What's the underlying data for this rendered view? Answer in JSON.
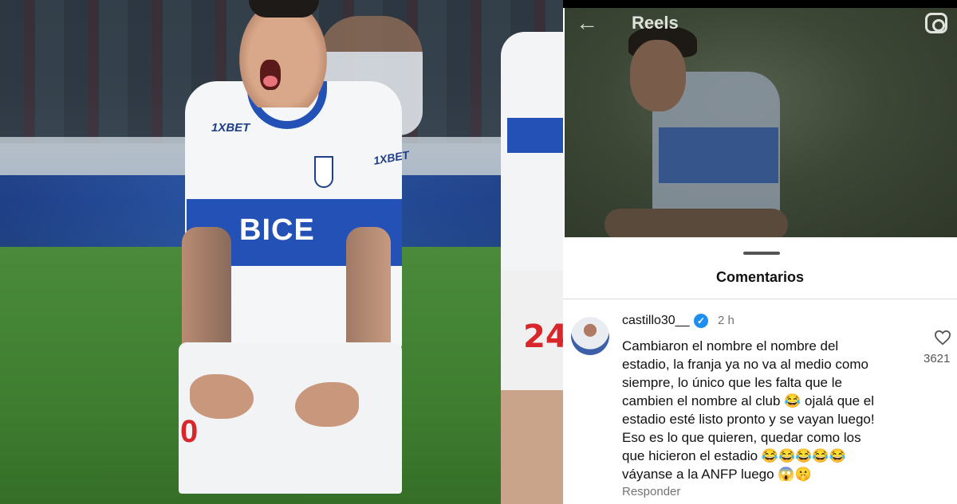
{
  "photo": {
    "shirt_sponsor": "BICE",
    "chest_logo": "1XBET",
    "sleeve_logo": "1XBET",
    "shorts_number": "0",
    "other_player_number": "24"
  },
  "reel_header": {
    "title": "Reels",
    "back_icon": "arrow-left-icon",
    "camera_icon": "camera-icon"
  },
  "comments_sheet": {
    "title": "Comentarios",
    "comment": {
      "username": "castillo30__",
      "verified": true,
      "time": "2 h",
      "lines": [
        "Cambiaron el nombre el nombre del",
        "estadio, la franja ya no va al medio como",
        "siempre, lo único que les falta que le",
        "cambien el nombre al club 😂 ojalá que el",
        "estadio esté listo pronto y se vayan luego!",
        "Eso es lo que quieren, quedar como los",
        "que hicieron el estadio 😂😂😂😂😂",
        "váyanse a la ANFP luego 😱🤫"
      ],
      "reply_label": "Responder",
      "like_count": "3621"
    }
  },
  "colors": {
    "uc_blue": "#2451b5",
    "verified_blue": "#1f8ef1",
    "muted_text": "#737373"
  }
}
